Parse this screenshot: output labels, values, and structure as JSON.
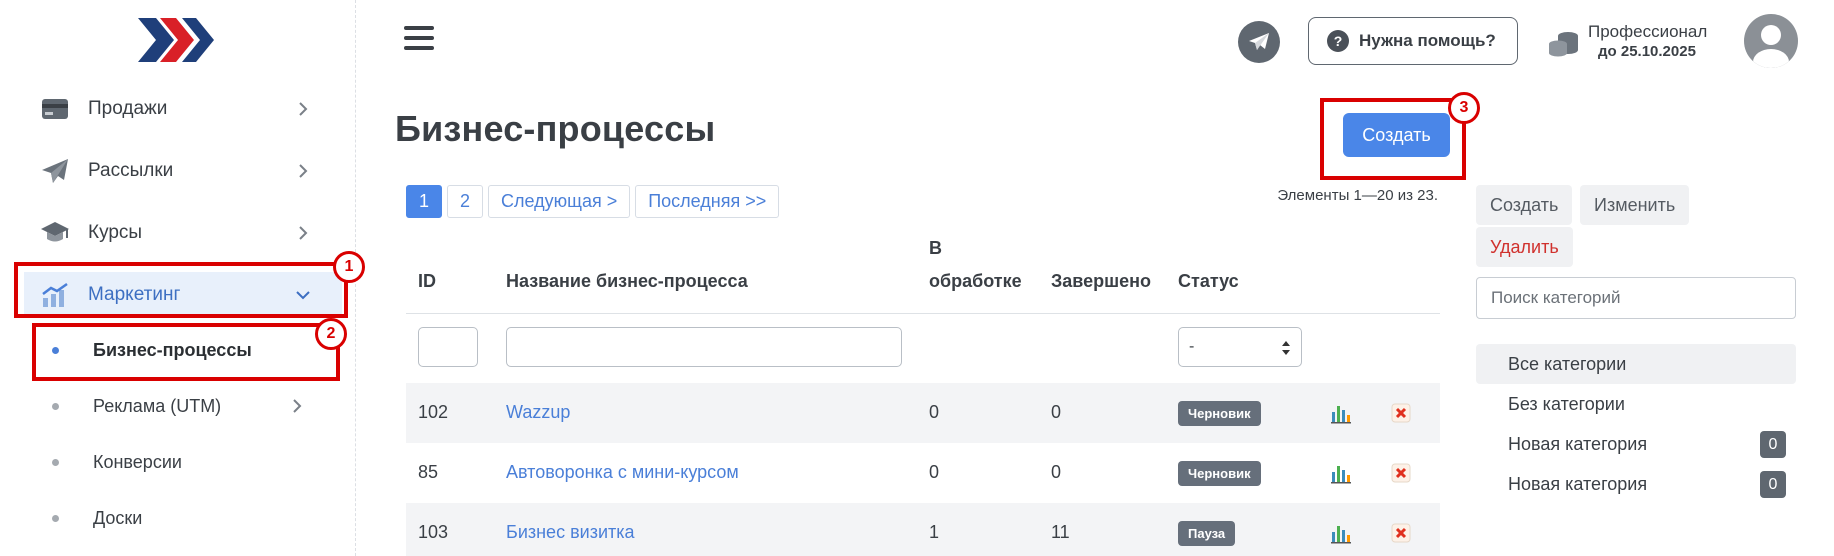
{
  "sidebar": {
    "items": [
      {
        "label": "Продажи",
        "icon": "card-icon"
      },
      {
        "label": "Рассылки",
        "icon": "paper-plane-icon"
      },
      {
        "label": "Курсы",
        "icon": "graduation-cap-icon"
      },
      {
        "label": "Маркетинг",
        "icon": "chart-up-icon"
      }
    ],
    "submenu": [
      {
        "label": "Бизнес-процессы"
      },
      {
        "label": "Реклама (UTM)"
      },
      {
        "label": "Конверсии"
      },
      {
        "label": "Доски"
      }
    ]
  },
  "annotations": [
    "1",
    "2",
    "3"
  ],
  "header": {
    "help_label": "Нужна помощь?",
    "help_icon_text": "?",
    "plan_name": "Профессионал",
    "plan_until": "до 25.10.2025"
  },
  "main": {
    "title": "Бизнес-процессы",
    "create_label": "Создать",
    "pagination": {
      "pages": [
        "1",
        "2"
      ],
      "next": "Следующая >",
      "last": "Последняя >>"
    },
    "summary": "Элементы 1—20 из 23.",
    "columns": {
      "id": "ID",
      "name": "Название бизнес-процесса",
      "in_progress_1": "В",
      "in_progress_2": "обработке",
      "completed": "Завершено",
      "status": "Статус"
    },
    "status_filter": "-",
    "rows": [
      {
        "id": "102",
        "name": "Wazzup",
        "in_progress": "0",
        "completed": "0",
        "status": "Черновик"
      },
      {
        "id": "85",
        "name": "Автоворонка с мини-курсом",
        "in_progress": "0",
        "completed": "0",
        "status": "Черновик"
      },
      {
        "id": "103",
        "name": "Бизнес визитка",
        "in_progress": "1",
        "completed": "11",
        "status": "Пауза"
      }
    ]
  },
  "right_panel": {
    "create": "Создать",
    "edit": "Изменить",
    "delete": "Удалить",
    "search_placeholder": "Поиск категорий",
    "categories": [
      {
        "label": "Все категории"
      },
      {
        "label": "Без категории"
      },
      {
        "label": "Новая категория",
        "count": "0"
      },
      {
        "label": "Новая категория",
        "count": "0"
      }
    ]
  },
  "colors": {
    "accent": "#4a86e8",
    "highlight": "#d90000",
    "badge": "#666f7b"
  }
}
